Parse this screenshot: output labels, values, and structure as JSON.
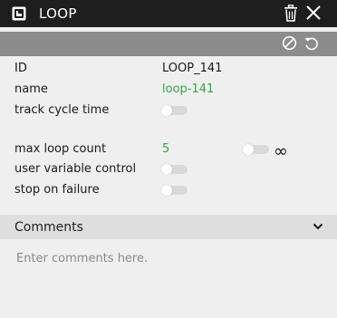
{
  "header": {
    "title": "LOOP",
    "icons": [
      "loop-block-icon",
      "trash-icon",
      "close-icon"
    ]
  },
  "toolbar": {
    "icons": [
      "disable-icon",
      "reset-icon"
    ]
  },
  "properties": {
    "id_label": "ID",
    "id_value": "LOOP_141",
    "name_label": "name",
    "name_value": "loop-141",
    "track_label": "track cycle time",
    "track_enabled": false,
    "max_label": "max loop count",
    "max_value": "5",
    "infinite_enabled": false,
    "infinity_symbol": "∞",
    "user_var_label": "user variable control",
    "user_var_enabled": false,
    "stop_label": "stop on failure",
    "stop_enabled": false
  },
  "comments": {
    "title": "Comments",
    "placeholder": "Enter comments here.",
    "value": ""
  },
  "colors": {
    "titlebar": "#1e1e1e",
    "toolbar": "#8c8c8c",
    "panel": "#efefef",
    "accent_green": "#3aa345",
    "toggle_off": "#d9d9d9"
  }
}
